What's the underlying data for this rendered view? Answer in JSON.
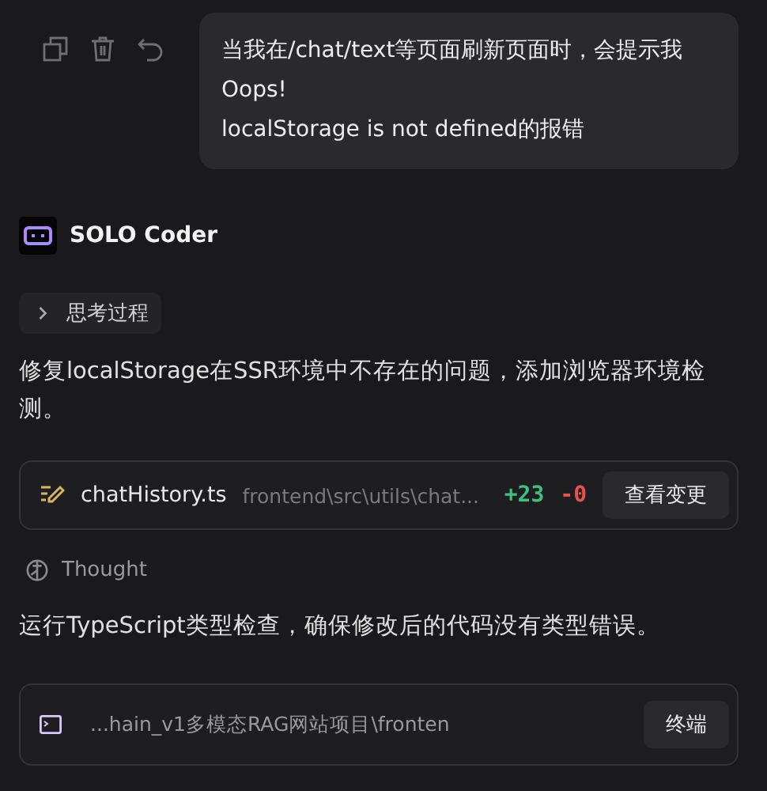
{
  "user_message": {
    "lines": [
      "当我在/chat/text等页面刷新页面时，会提示我Oops!",
      "localStorage is not defined的报错"
    ]
  },
  "assistant": {
    "name": "SOLO Coder"
  },
  "thinking": {
    "label": "思考过程",
    "expanded": false
  },
  "summary": "修复localStorage在SSR环境中不存在的问题，添加浏览器环境检测。",
  "file_change": {
    "file": "chatHistory.ts",
    "path": "frontend\\src\\utils\\chat...",
    "added": "+23",
    "removed": "-0",
    "button": "查看变更"
  },
  "thought": {
    "label": "Thought"
  },
  "step": "运行TypeScript类型检查，确保修改后的代码没有类型错误。",
  "terminal": {
    "path": "...hain_v1多模态RAG网站项目\\fronten",
    "button": "终端"
  }
}
